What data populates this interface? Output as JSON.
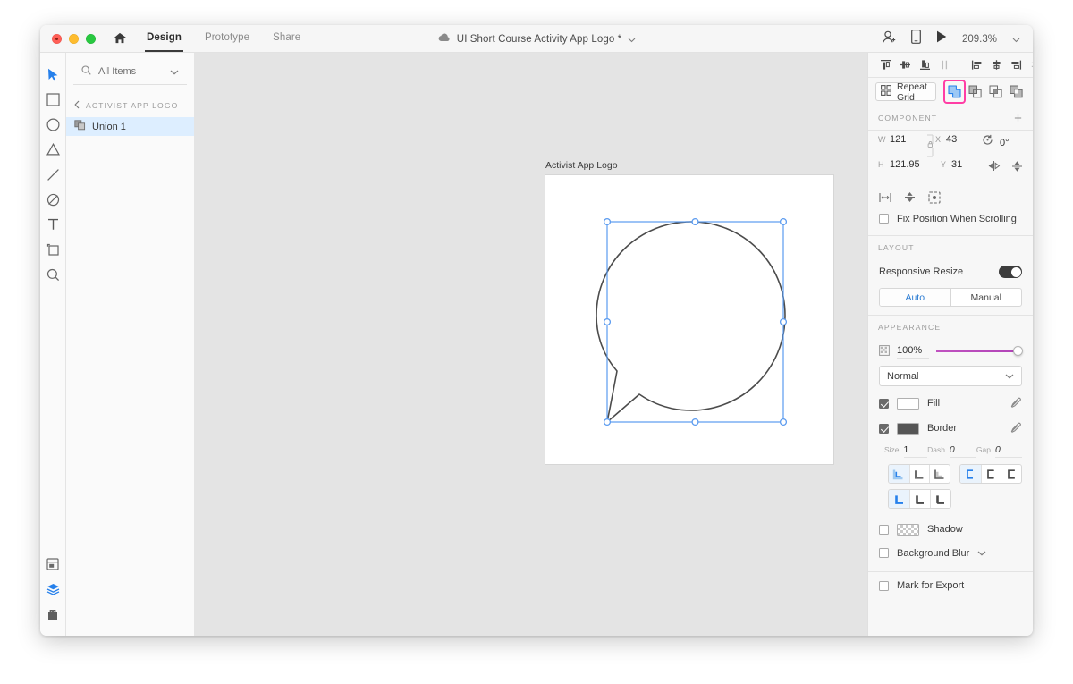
{
  "titlebar": {
    "home_icon": "home-icon",
    "tabs": [
      {
        "label": "Design",
        "active": true
      },
      {
        "label": "Prototype",
        "active": false
      },
      {
        "label": "Share",
        "active": false
      }
    ],
    "cloud_icon": "cloud-icon",
    "document_title": "UI Short Course Activity App Logo * ",
    "title_chevron": "chevron-down-icon",
    "invite_icon": "invite-user-icon",
    "device_preview_icon": "mobile-device-icon",
    "play_icon": "play-icon",
    "zoom_level": "209.3%",
    "zoom_chevron": "chevron-down-icon"
  },
  "toolbar": {
    "tools": [
      {
        "name": "select-tool",
        "active": true
      },
      {
        "name": "rectangle-tool",
        "active": false
      },
      {
        "name": "ellipse-tool",
        "active": false
      },
      {
        "name": "triangle-tool",
        "active": false
      },
      {
        "name": "line-tool",
        "active": false
      },
      {
        "name": "pen-tool",
        "active": false
      },
      {
        "name": "text-tool",
        "active": false
      },
      {
        "name": "artboard-tool",
        "active": false
      },
      {
        "name": "zoom-tool",
        "active": false
      }
    ],
    "bottom_tools": [
      {
        "name": "assets-panel-icon",
        "active": false
      },
      {
        "name": "layers-panel-icon",
        "active": true
      },
      {
        "name": "plugins-panel-icon",
        "active": false
      }
    ]
  },
  "layers": {
    "filter_label": "All Items",
    "filter_icon": "search-icon",
    "filter_chevron": "chevron-down-icon",
    "back_icon": "chevron-left-icon",
    "group_name": "ACTIVIST APP LOGO",
    "items": [
      {
        "name": "Union 1",
        "icon": "boolean-group-icon",
        "selected": true
      }
    ]
  },
  "canvas": {
    "artboard_label": "Activist App Logo",
    "selection_color": "#4a90e2",
    "shape_stroke": "#4c4c4c",
    "shape_fill": "#ffffff"
  },
  "right_panel": {
    "align_group_1": [
      {
        "name": "align-top-icon"
      },
      {
        "name": "align-vertical-center-icon"
      },
      {
        "name": "align-bottom-icon"
      },
      {
        "name": "distribute-vertical-icon"
      }
    ],
    "align_group_2": [
      {
        "name": "align-left-icon"
      },
      {
        "name": "align-horizontal-center-icon"
      },
      {
        "name": "align-right-icon"
      },
      {
        "name": "distribute-horizontal-icon"
      }
    ],
    "repeat_grid": {
      "label": "Repeat Grid",
      "icon": "repeat-grid-icon"
    },
    "boolean_ops": [
      {
        "name": "boolean-add-icon",
        "highlighted": true
      },
      {
        "name": "boolean-subtract-icon",
        "highlighted": false
      },
      {
        "name": "boolean-intersect-icon",
        "highlighted": false
      },
      {
        "name": "boolean-exclude-overlap-icon",
        "highlighted": false
      }
    ],
    "highlight_color": "#ff3ea5",
    "component": {
      "title": "COMPONENT",
      "add_icon": "plus-icon",
      "w_label": "W",
      "w_value": "121",
      "h_label": "H",
      "h_value": "121.95",
      "x_label": "X",
      "x_value": "43",
      "y_label": "Y",
      "y_value": "31",
      "rotation_icon": "rotate-icon",
      "rotation_value": "0°",
      "flip_horizontal_icon": "flip-horizontal-icon",
      "flip_vertical_icon": "flip-vertical-icon",
      "lock_icon": "lock-aspect-ratio-icon",
      "extra_icons": [
        {
          "name": "corner-radius-icon"
        },
        {
          "name": "path-join-icon"
        },
        {
          "name": "scale-icon"
        }
      ],
      "fix_position_label": "Fix Position When Scrolling",
      "fix_position_checked": false
    },
    "layout": {
      "title": "LAYOUT",
      "responsive_label": "Responsive Resize",
      "responsive_on": true,
      "auto_label": "Auto",
      "manual_label": "Manual",
      "selected_mode": "Auto"
    },
    "appearance": {
      "title": "APPEARANCE",
      "opacity_icon": "opacity-icon",
      "opacity_value": "100%",
      "blend_mode": "Normal",
      "blend_chevron": "chevron-down-icon",
      "fill": {
        "label": "Fill",
        "checked": true,
        "color": "#ffffff",
        "eyedropper_icon": "eyedropper-icon"
      },
      "border": {
        "label": "Border",
        "checked": true,
        "color": "#555555",
        "eyedropper_icon": "eyedropper-icon",
        "size_label": "Size",
        "size_value": "1",
        "dash_label": "Dash",
        "dash_value": "0",
        "gap_label": "Gap",
        "gap_value": "0",
        "align_icons": [
          {
            "name": "border-align-inside-icon",
            "selected": true
          },
          {
            "name": "border-align-center-icon",
            "selected": false
          },
          {
            "name": "border-align-outside-icon",
            "selected": false
          }
        ],
        "cap_icons": [
          {
            "name": "border-cap-butt-icon",
            "selected": true
          },
          {
            "name": "border-cap-round-icon",
            "selected": false
          },
          {
            "name": "border-cap-square-icon",
            "selected": false
          }
        ],
        "join_icons": [
          {
            "name": "border-join-miter-icon",
            "selected": true
          },
          {
            "name": "border-join-round-icon",
            "selected": false
          },
          {
            "name": "border-join-bevel-icon",
            "selected": false
          }
        ]
      },
      "shadow": {
        "label": "Shadow",
        "checked": false,
        "swatch_icon": "transparent-swatch-icon"
      },
      "background_blur": {
        "label": "Background Blur",
        "checked": false,
        "chevron": "chevron-down-icon"
      }
    },
    "mark_for_export": {
      "label": "Mark for Export",
      "checked": false
    }
  }
}
